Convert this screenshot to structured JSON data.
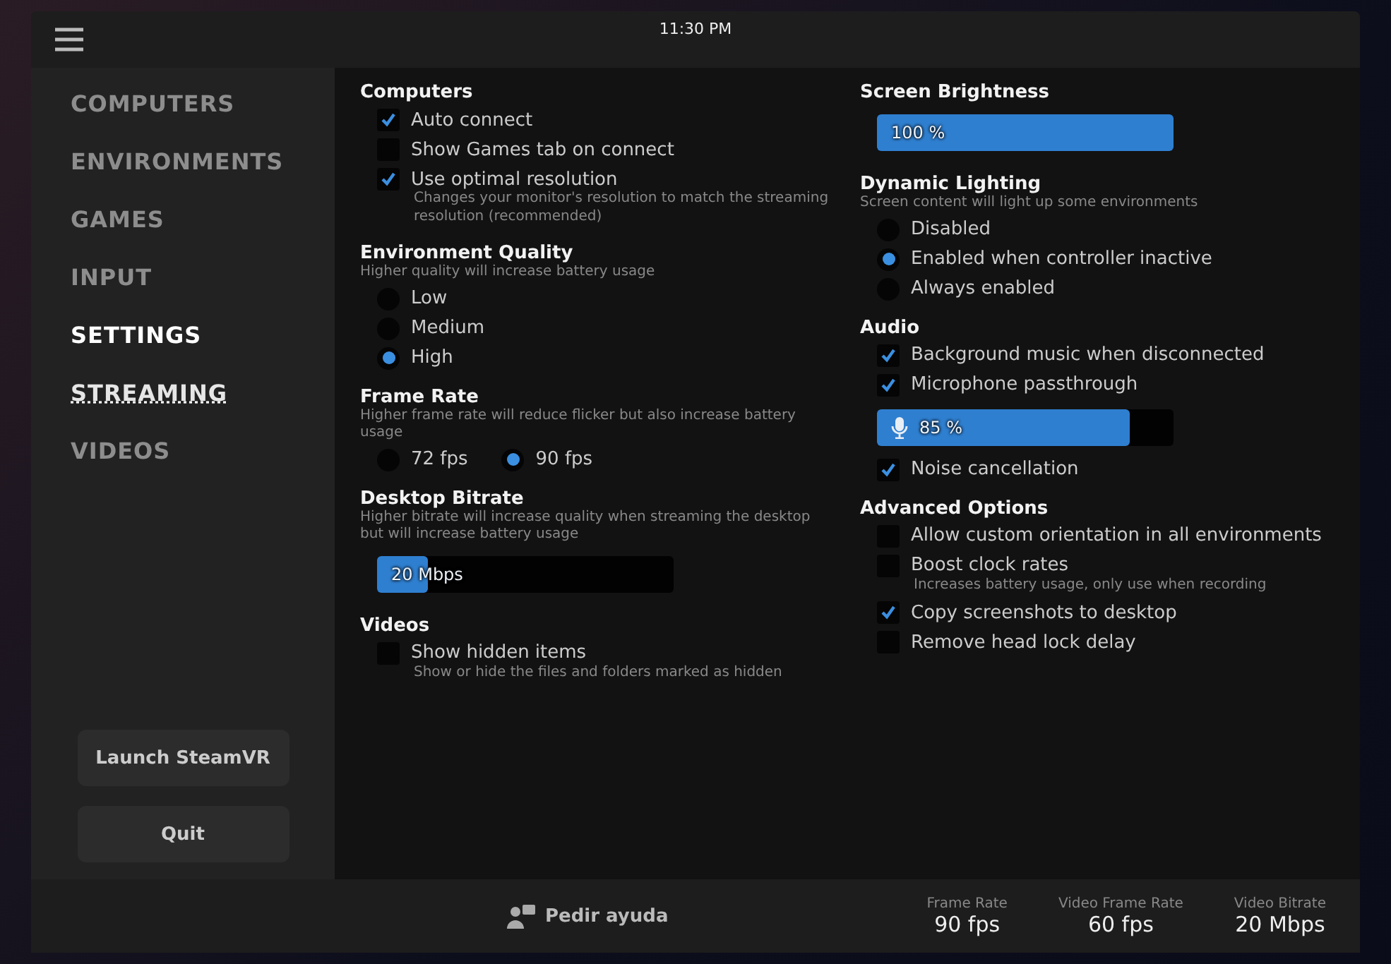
{
  "clock": "11:30 PM",
  "sidebar": {
    "items": [
      {
        "label": "COMPUTERS",
        "selected": false,
        "hovered": false
      },
      {
        "label": "ENVIRONMENTS",
        "selected": false,
        "hovered": false
      },
      {
        "label": "GAMES",
        "selected": false,
        "hovered": false
      },
      {
        "label": "INPUT",
        "selected": false,
        "hovered": false
      },
      {
        "label": "SETTINGS",
        "selected": true,
        "hovered": false
      },
      {
        "label": "STREAMING",
        "selected": false,
        "hovered": true
      },
      {
        "label": "VIDEOS",
        "selected": false,
        "hovered": false
      }
    ],
    "buttons": [
      "Launch SteamVR",
      "Quit"
    ]
  },
  "columns": [
    [
      {
        "title": "Computers",
        "kind": "list",
        "items": [
          {
            "kind": "checkbox",
            "label": "Auto connect",
            "checked": true
          },
          {
            "kind": "checkbox",
            "label": "Show Games tab on connect",
            "checked": false
          },
          {
            "kind": "checkbox",
            "label": "Use optimal resolution",
            "checked": true,
            "description": "Changes your monitor's resolution to match the streaming resolution (recommended)"
          }
        ]
      },
      {
        "title": "Environment Quality",
        "description": "Higher quality will increase battery usage",
        "kind": "list",
        "items": [
          {
            "kind": "radio",
            "label": "Low",
            "selected": false
          },
          {
            "kind": "radio",
            "label": "Medium",
            "selected": false
          },
          {
            "kind": "radio",
            "label": "High",
            "selected": true
          }
        ]
      },
      {
        "title": "Frame Rate",
        "description": "Higher frame rate will reduce flicker but also increase battery usage",
        "kind": "inline",
        "items": [
          {
            "kind": "radio",
            "label": "72 fps",
            "selected": false
          },
          {
            "kind": "radio",
            "label": "90 fps",
            "selected": true
          }
        ]
      },
      {
        "title": "Desktop Bitrate",
        "description": "Higher bitrate will increase quality when streaming the desktop but will increase battery usage",
        "kind": "list",
        "items": [
          {
            "kind": "slider",
            "reading": "20 Mbps",
            "level": 0.17
          }
        ]
      },
      {
        "title": "Videos",
        "kind": "list",
        "items": [
          {
            "kind": "checkbox",
            "label": "Show hidden items",
            "checked": false,
            "description": "Show or hide the files and folders marked as hidden"
          }
        ]
      }
    ],
    [
      {
        "title": "Screen Brightness",
        "kind": "list",
        "items": [
          {
            "kind": "slider",
            "reading": "100 %",
            "level": 1
          }
        ]
      },
      {
        "title": "Dynamic Lighting",
        "description": "Screen content will light up some environments",
        "kind": "list",
        "items": [
          {
            "kind": "radio",
            "label": "Disabled",
            "selected": false
          },
          {
            "kind": "radio",
            "label": "Enabled when controller inactive",
            "selected": true
          },
          {
            "kind": "radio",
            "label": "Always enabled",
            "selected": false
          }
        ]
      },
      {
        "title": "Audio",
        "kind": "list",
        "items": [
          {
            "kind": "checkbox",
            "label": "Background music when disconnected",
            "checked": true
          },
          {
            "kind": "checkbox",
            "label": "Microphone passthrough",
            "checked": true
          },
          {
            "kind": "mic_slider",
            "reading": "85 %",
            "level": 0.85
          },
          {
            "kind": "checkbox",
            "label": "Noise cancellation",
            "checked": true
          }
        ]
      },
      {
        "title": "Advanced Options",
        "kind": "list",
        "items": [
          {
            "kind": "checkbox",
            "label": "Allow custom orientation in all environments",
            "checked": false
          },
          {
            "kind": "checkbox",
            "label": "Boost clock rates",
            "checked": false,
            "description": "Increases battery usage, only use when recording"
          },
          {
            "kind": "checkbox",
            "label": "Copy screenshots to desktop",
            "checked": true
          },
          {
            "kind": "checkbox",
            "label": "Remove head lock delay",
            "checked": false
          }
        ]
      }
    ]
  ],
  "footer": {
    "help": "Pedir ayuda",
    "stats": [
      {
        "label": "Frame Rate",
        "value": "90 fps"
      },
      {
        "label": "Video Frame Rate",
        "value": "60 fps"
      },
      {
        "label": "Video Bitrate",
        "value": "20 Mbps"
      }
    ]
  }
}
